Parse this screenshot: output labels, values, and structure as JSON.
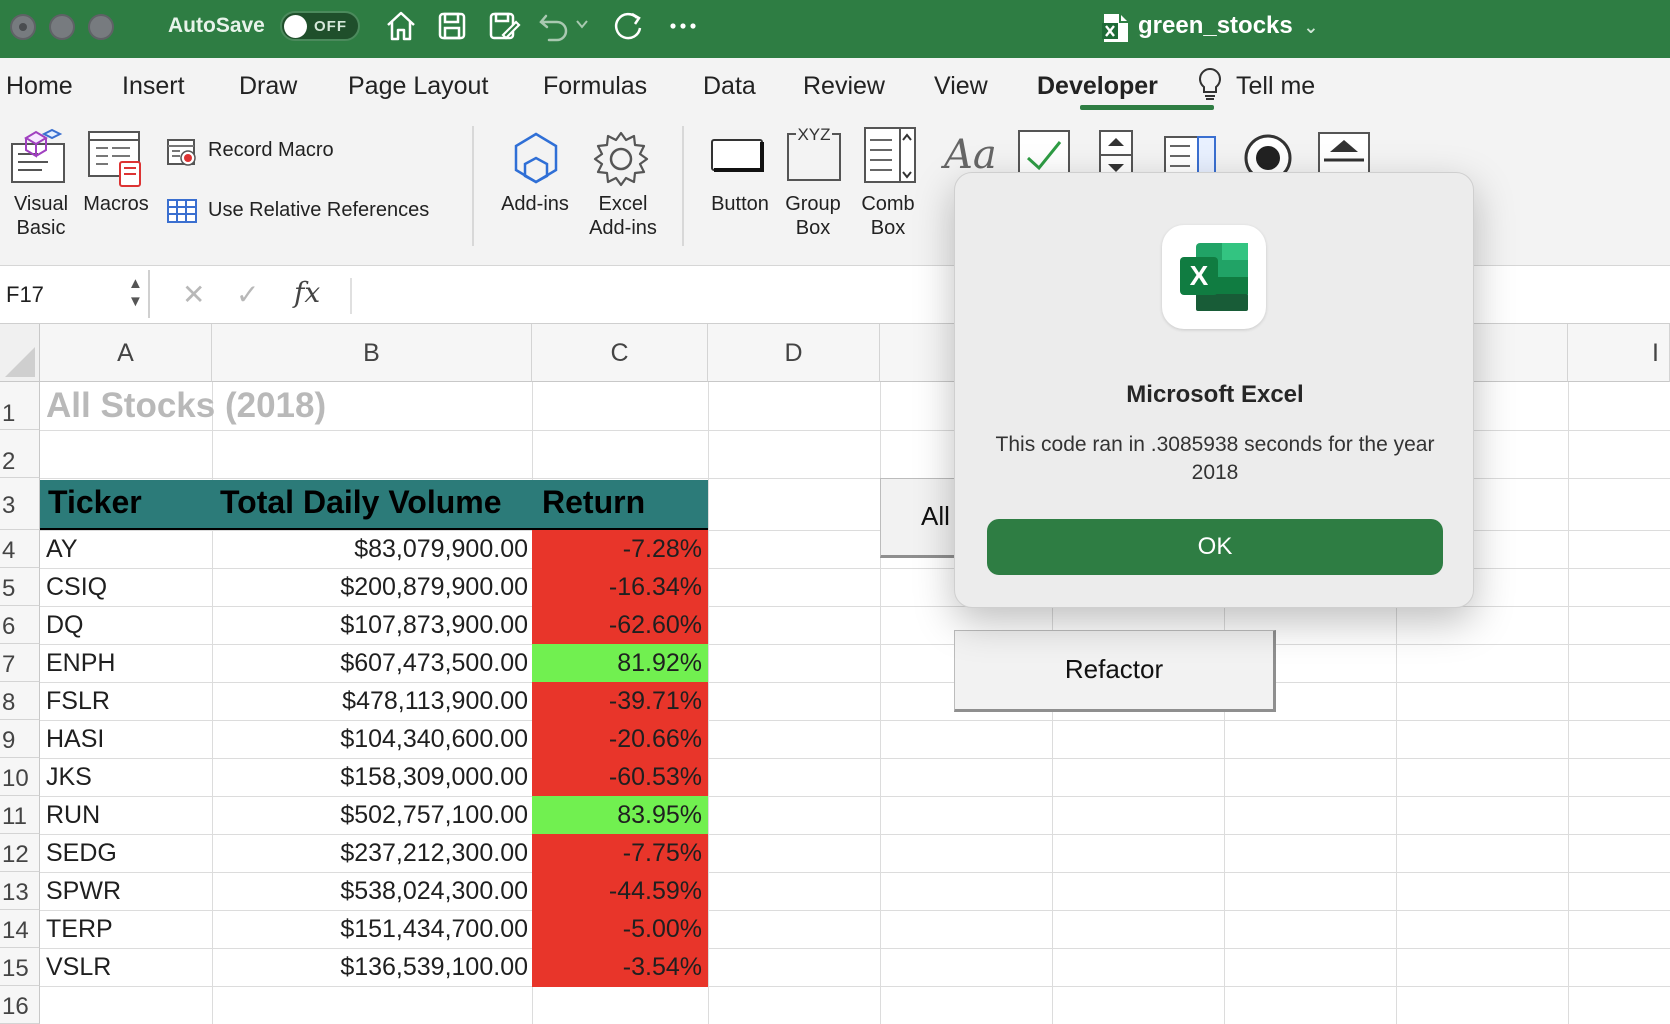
{
  "titlebar": {
    "autosave_label": "AutoSave",
    "autosave_state": "OFF",
    "document_title": "green_stocks"
  },
  "tabs": [
    "Home",
    "Insert",
    "Draw",
    "Page Layout",
    "Formulas",
    "Data",
    "Review",
    "View",
    "Developer",
    "Tell me"
  ],
  "active_tab": "Developer",
  "ribbon": {
    "visual_basic": "Visual\nBasic",
    "macros": "Macros",
    "record_macro": "Record Macro",
    "use_relative": "Use Relative References",
    "add_ins": "Add-ins",
    "excel_add_ins": "Excel\nAdd-ins",
    "button": "Button",
    "group_box": "Group\nBox",
    "combo_box": "Comb\nBox",
    "group_box_icon_text": "XYZ",
    "label_icon_text": "Aa"
  },
  "formula_bar": {
    "name_box": "F17",
    "fx": "fx"
  },
  "columns": [
    "A",
    "B",
    "C",
    "D",
    "",
    "",
    "",
    "H",
    "I"
  ],
  "rows": [
    "1",
    "2",
    "3",
    "4",
    "5",
    "6",
    "7",
    "8",
    "9",
    "10",
    "11",
    "12",
    "13",
    "14",
    "15",
    "16"
  ],
  "sheet": {
    "title": "All Stocks (2018)",
    "headers": [
      "Ticker",
      "Total Daily Volume",
      "Return"
    ],
    "data": [
      {
        "ticker": "AY",
        "volume": "$83,079,900.00",
        "return": "-7.28%",
        "positive": false
      },
      {
        "ticker": "CSIQ",
        "volume": "$200,879,900.00",
        "return": "-16.34%",
        "positive": false
      },
      {
        "ticker": "DQ",
        "volume": "$107,873,900.00",
        "return": "-62.60%",
        "positive": false
      },
      {
        "ticker": "ENPH",
        "volume": "$607,473,500.00",
        "return": "81.92%",
        "positive": true
      },
      {
        "ticker": "FSLR",
        "volume": "$478,113,900.00",
        "return": "-39.71%",
        "positive": false
      },
      {
        "ticker": "HASI",
        "volume": "$104,340,600.00",
        "return": "-20.66%",
        "positive": false
      },
      {
        "ticker": "JKS",
        "volume": "$158,309,000.00",
        "return": "-60.53%",
        "positive": false
      },
      {
        "ticker": "RUN",
        "volume": "$502,757,100.00",
        "return": "83.95%",
        "positive": true
      },
      {
        "ticker": "SEDG",
        "volume": "$237,212,300.00",
        "return": "-7.75%",
        "positive": false
      },
      {
        "ticker": "SPWR",
        "volume": "$538,024,300.00",
        "return": "-44.59%",
        "positive": false
      },
      {
        "ticker": "TERP",
        "volume": "$151,434,700.00",
        "return": "-5.00%",
        "positive": false
      },
      {
        "ticker": "VSLR",
        "volume": "$136,539,100.00",
        "return": "-3.54%",
        "positive": false
      }
    ]
  },
  "sheet_buttons": {
    "all_label": "All",
    "refactor_label": "Refactor"
  },
  "dialog": {
    "app_name": "Microsoft Excel",
    "message": "This code ran in  .3085938 seconds for the year 2018",
    "ok_label": "OK",
    "icon_letter": "X"
  },
  "colors": {
    "brand_green": "#2e7d43",
    "header_teal": "#2c7b79",
    "negative_red": "#e8352a",
    "positive_green": "#71f050"
  }
}
